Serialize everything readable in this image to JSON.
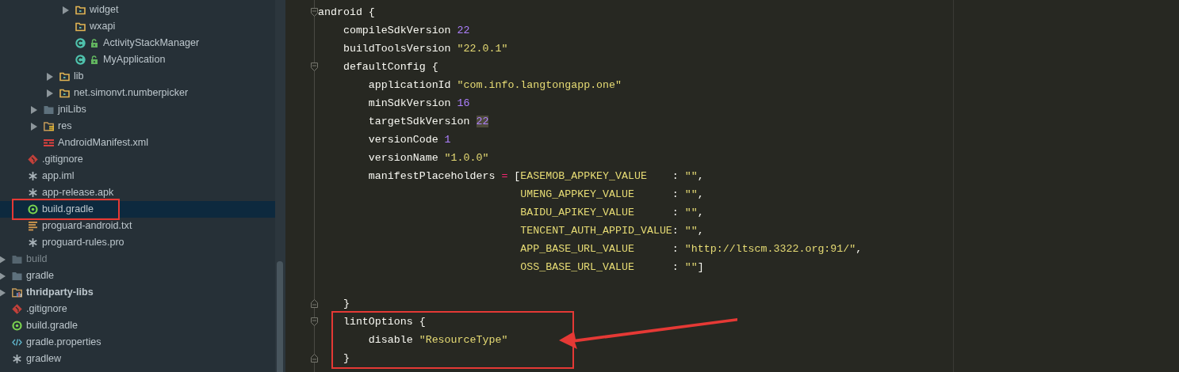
{
  "project_tree": [
    {
      "children": [
        {
          "children": [
            {
              "children": [
                {
                  "children": [
                    {
                      "label": "widget",
                      "kind": "package",
                      "expanded": false,
                      "selected": false
                    },
                    {
                      "label": "wxapi",
                      "kind": "package",
                      "selected": false
                    },
                    {
                      "label": "ActivityStackManager",
                      "kind": "class",
                      "selected": false
                    },
                    {
                      "label": "MyApplication",
                      "kind": "class",
                      "selected": false
                    }
                  ]
                },
                {
                  "label": "lib",
                  "kind": "package",
                  "expanded": false,
                  "selected": false
                },
                {
                  "label": "net.simonvt.numberpicker",
                  "kind": "package",
                  "expanded": false,
                  "selected": false
                }
              ]
            },
            {
              "label": "jniLibs",
              "kind": "folder",
              "expanded": false,
              "selected": false
            },
            {
              "label": "res",
              "kind": "resources",
              "expanded": false,
              "selected": false
            },
            {
              "label": "AndroidManifest.xml",
              "kind": "manifest",
              "selected": false
            }
          ]
        },
        {
          "label": ".gitignore",
          "kind": "git",
          "selected": false
        },
        {
          "label": "app.iml",
          "kind": "file",
          "selected": false
        },
        {
          "label": "app-release.apk",
          "kind": "file",
          "selected": false
        },
        {
          "label": "build.gradle",
          "kind": "gradle",
          "selected": true,
          "boxed": true
        },
        {
          "label": "proguard-android.txt",
          "kind": "text",
          "selected": false
        },
        {
          "label": "proguard-rules.pro",
          "kind": "file",
          "selected": false
        }
      ]
    },
    {
      "label": "build",
      "kind": "excluded",
      "expanded": false,
      "selected": false
    },
    {
      "label": "gradle",
      "kind": "folder",
      "expanded": false,
      "selected": false
    },
    {
      "label": "thridparty-libs",
      "kind": "module",
      "expanded": false,
      "selected": false
    },
    {
      "label": ".gitignore",
      "kind": "git",
      "selected": false
    },
    {
      "label": "build.gradle",
      "kind": "gradle",
      "selected": false
    },
    {
      "label": "gradle.properties",
      "kind": "xml",
      "selected": false
    },
    {
      "label": "gradlew",
      "kind": "file",
      "selected": false
    }
  ],
  "code_lines": [
    {
      "kind": "code",
      "fold_start": true,
      "fold_end": false,
      "tokens": [
        {
          "t": "android {",
          "kind": "plain"
        }
      ]
    },
    {
      "kind": "code",
      "fold_start": false,
      "fold_end": false,
      "tokens": [
        {
          "t": "    compileSdkVersion ",
          "kind": "plain"
        },
        {
          "t": "22",
          "kind": "number"
        }
      ]
    },
    {
      "kind": "code",
      "fold_start": false,
      "fold_end": false,
      "tokens": [
        {
          "t": "    buildToolsVersion ",
          "kind": "plain"
        },
        {
          "t": "\"22.0.1\"",
          "kind": "string"
        }
      ]
    },
    {
      "kind": "code",
      "fold_start": true,
      "fold_end": false,
      "tokens": [
        {
          "t": "    defaultConfig {",
          "kind": "plain"
        }
      ]
    },
    {
      "kind": "code",
      "fold_start": false,
      "fold_end": false,
      "tokens": [
        {
          "t": "        applicationId ",
          "kind": "plain"
        },
        {
          "t": "\"com.info.langtongapp.one\"",
          "kind": "string"
        }
      ]
    },
    {
      "kind": "code",
      "fold_start": false,
      "fold_end": false,
      "tokens": [
        {
          "t": "        minSdkVersion ",
          "kind": "plain"
        },
        {
          "t": "16",
          "kind": "number"
        }
      ]
    },
    {
      "kind": "code",
      "fold_start": false,
      "fold_end": false,
      "tokens": [
        {
          "t": "        targetSdkVersion ",
          "kind": "plain"
        },
        {
          "t": "22",
          "kind": "number_match"
        }
      ]
    },
    {
      "kind": "code",
      "fold_start": false,
      "fold_end": false,
      "tokens": [
        {
          "t": "        versionCode ",
          "kind": "plain"
        },
        {
          "t": "1",
          "kind": "number"
        }
      ]
    },
    {
      "kind": "code",
      "fold_start": false,
      "fold_end": false,
      "tokens": [
        {
          "t": "        versionName ",
          "kind": "plain"
        },
        {
          "t": "\"1.0.0\"",
          "kind": "string"
        }
      ]
    },
    {
      "kind": "code",
      "fold_start": false,
      "fold_end": false,
      "tokens": [
        {
          "t": "        manifestPlaceholders ",
          "kind": "plain"
        },
        {
          "t": "=",
          "kind": "operator"
        },
        {
          "t": " [",
          "kind": "plain"
        },
        {
          "t": "EASEMOB_APPKEY_VALUE",
          "kind": "key"
        },
        {
          "t": "    : ",
          "kind": "plain"
        },
        {
          "t": "\"\"",
          "kind": "string"
        },
        {
          "t": ",",
          "kind": "plain"
        }
      ]
    },
    {
      "kind": "continuation",
      "fold_start": false,
      "fold_end": false,
      "tokens": [
        {
          "t": "UMENG_APPKEY_VALUE",
          "kind": "key"
        },
        {
          "t": "      : ",
          "kind": "plain"
        },
        {
          "t": "\"\"",
          "kind": "string"
        },
        {
          "t": ",",
          "kind": "plain"
        }
      ]
    },
    {
      "kind": "continuation",
      "fold_start": false,
      "fold_end": false,
      "tokens": [
        {
          "t": "BAIDU_APIKEY_VALUE",
          "kind": "key"
        },
        {
          "t": "      : ",
          "kind": "plain"
        },
        {
          "t": "\"\"",
          "kind": "string"
        },
        {
          "t": ",",
          "kind": "plain"
        }
      ]
    },
    {
      "kind": "continuation",
      "fold_start": false,
      "fold_end": false,
      "tokens": [
        {
          "t": "TENCENT_AUTH_APPID_VALUE",
          "kind": "key"
        },
        {
          "t": ": ",
          "kind": "plain"
        },
        {
          "t": "\"\"",
          "kind": "string"
        },
        {
          "t": ",",
          "kind": "plain"
        }
      ]
    },
    {
      "kind": "continuation",
      "fold_start": false,
      "fold_end": false,
      "tokens": [
        {
          "t": "APP_BASE_URL_VALUE",
          "kind": "key"
        },
        {
          "t": "      : ",
          "kind": "plain"
        },
        {
          "t": "\"http://ltscm.3322.org:91/\"",
          "kind": "string"
        },
        {
          "t": ",",
          "kind": "plain"
        }
      ]
    },
    {
      "kind": "continuation",
      "fold_start": false,
      "fold_end": false,
      "tokens": [
        {
          "t": "OSS_BASE_URL_VALUE",
          "kind": "key"
        },
        {
          "t": "      : ",
          "kind": "plain"
        },
        {
          "t": "\"\"",
          "kind": "string"
        },
        {
          "t": "]",
          "kind": "plain"
        }
      ]
    },
    {
      "kind": "blank",
      "fold_start": false,
      "fold_end": false
    },
    {
      "kind": "code",
      "fold_start": false,
      "fold_end": true,
      "tokens": [
        {
          "t": "    }",
          "kind": "plain"
        }
      ]
    },
    {
      "kind": "code",
      "fold_start": true,
      "fold_end": false,
      "boxed": true,
      "tokens": [
        {
          "t": "    lintOptions {",
          "kind": "plain"
        }
      ]
    },
    {
      "kind": "code",
      "fold_start": false,
      "fold_end": false,
      "boxed": true,
      "tokens": [
        {
          "t": "        disable ",
          "kind": "plain"
        },
        {
          "t": "\"ResourceType\"",
          "kind": "string"
        }
      ]
    },
    {
      "kind": "code",
      "fold_start": false,
      "fold_end": true,
      "boxed": true,
      "tokens": [
        {
          "t": "    }",
          "kind": "plain"
        }
      ]
    }
  ]
}
